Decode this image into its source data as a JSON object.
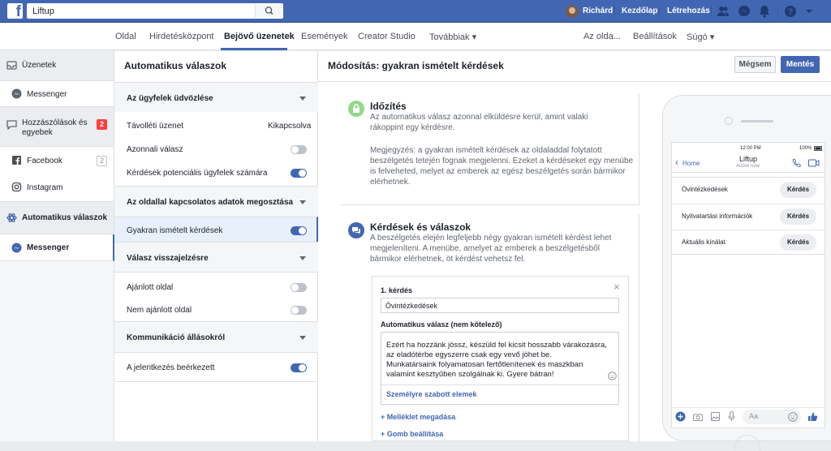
{
  "topbar": {
    "search_value": "Liftup",
    "user_name": "Richárd",
    "links": [
      "Kezdőlap",
      "Létrehozás"
    ]
  },
  "pagenav": {
    "items": [
      "Oldal",
      "Hirdetésközpont",
      "Bejövő üzenetek",
      "Események",
      "Creator Studio",
      "Továbbiak ▾"
    ],
    "right_items": [
      "Az olda...",
      "Beállítások",
      "Súgó ▾"
    ]
  },
  "leftnav": {
    "items": [
      {
        "label": "Üzenetek"
      },
      {
        "label": "Messenger"
      },
      {
        "label": "Hozzászólások és egyebek",
        "badge": "2"
      },
      {
        "label": "Facebook",
        "badge": "2"
      },
      {
        "label": "Instagram"
      },
      {
        "label": "Automatikus válaszok"
      },
      {
        "label": "Messenger"
      }
    ]
  },
  "settings": {
    "title": "Automatikus válaszok",
    "sections": [
      {
        "label": "Az ügyfelek üdvözlése"
      },
      {
        "label": "Az oldallal kapcsolatos adatok megosztása"
      },
      {
        "label": "Válasz visszajelzésre"
      },
      {
        "label": "Kommunikáció állásokról"
      }
    ],
    "rows": [
      {
        "label": "Távolléti üzenet",
        "value": "Kikapcsolva"
      },
      {
        "label": "Azonnali válasz",
        "on": false
      },
      {
        "label": "Kérdések potenciális ügyfelek számára",
        "on": true
      },
      {
        "label": "Gyakran ismételt kérdések",
        "on": true
      },
      {
        "label": "Ajánlott oldal",
        "on": false
      },
      {
        "label": "Nem ajánlott oldal",
        "on": false
      },
      {
        "label": "A jelentkezés beérkezett",
        "on": true
      }
    ]
  },
  "main": {
    "title": "Módosítás: gyakran ismételt kérdések",
    "cancel": "Mégsem",
    "save": "Mentés",
    "timing": {
      "title": "Időzítés",
      "text": "Az automatikus válasz azonnal elküldésre kerül, amint valaki rákoppint egy kérdésre.",
      "note": "Megjegyzés: a gyakran ismételt kérdések az oldaladdal folytatott beszélgetés tetején fognak megjelenni. Ezeket a kérdéseket egy menübe is felveheted, melyet az emberek az egész beszélgetés során bármikor elérhetnek."
    },
    "qa": {
      "title": "Kérdések és válaszok",
      "text": "A beszélgetés elején legfeljebb négy gyakran ismételt kérdést lehet megjeleníteni. A menübe, amelyet az emberek a beszélgetésből bármikor elérhetnek, öt kérdést vehetsz fel.",
      "q_label": "1. kérdés",
      "q_value": "Óvintézkedések",
      "a_label": "Automatikus válasz (nem kötelező)",
      "a_value": "Ezért ha hozzánk jössz, készüld fel kicsit hosszabb várakozásra, az eladótérbe egyszerre csak egy vevő jöhet be.\nMunkatársaink folyamatosan fertőtlenítenek és maszkban valamint kesztyűben szolgálnak ki. Gyere bátran!",
      "custom": "Személyre szabott elemek",
      "attach": "+ Melléklet megadása",
      "button": "+ Gomb beállítása"
    }
  },
  "phone": {
    "time": "12:00 PM",
    "battery": "100%",
    "back": "Home",
    "page_name": "Liftup",
    "status": "Active now",
    "questions": [
      "Óvintézkedések",
      "Nyitvatartási információk",
      "Aktuális kínálat"
    ],
    "ask": "Kérdés",
    "input_placeholder": "Aa"
  }
}
